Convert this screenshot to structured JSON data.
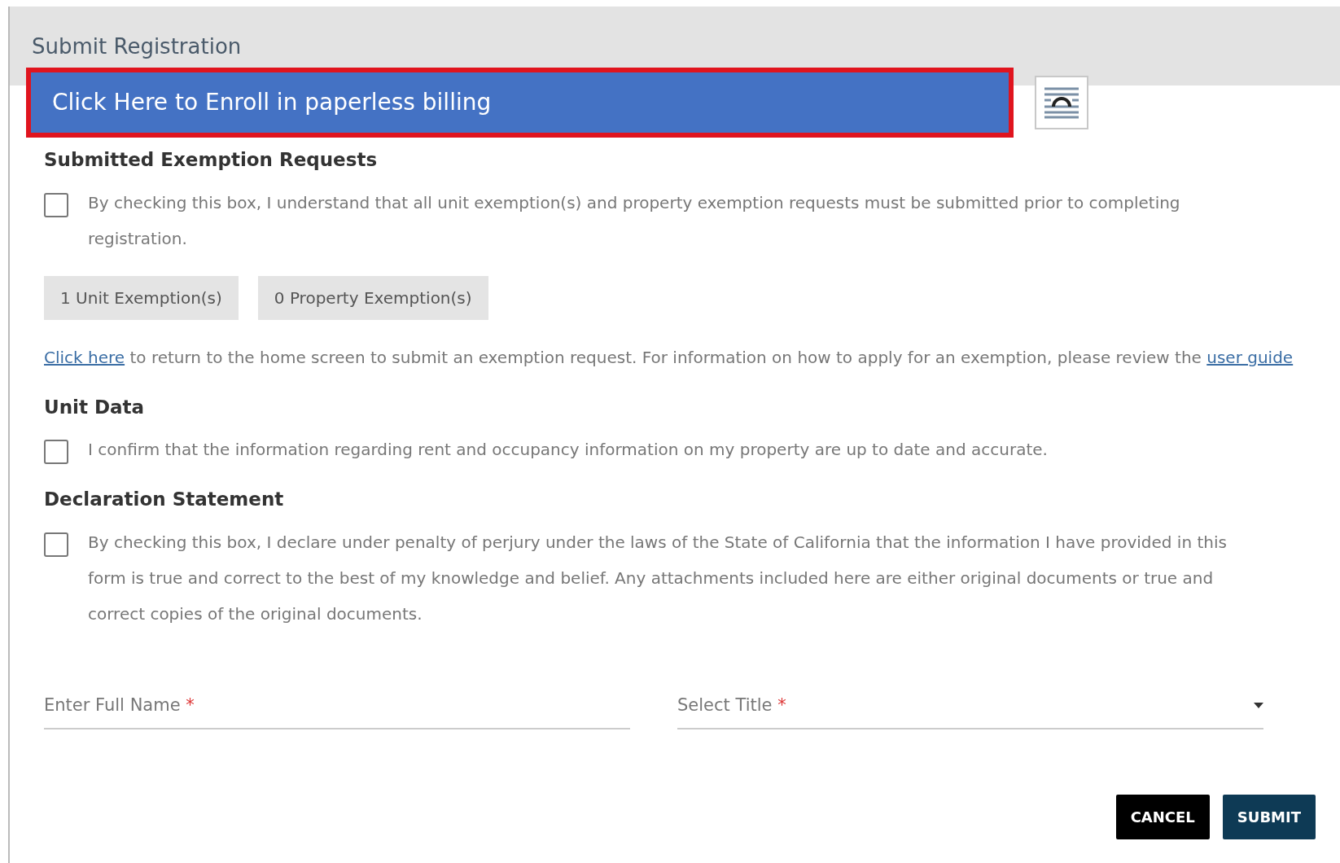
{
  "dialog": {
    "title": "Submit Registration"
  },
  "banner": {
    "label": "Click Here to Enroll in paperless billing"
  },
  "sections": [
    {
      "heading": "Submitted Exemption Requests",
      "checkbox": {
        "checked": false,
        "label": "By checking this box, I understand that all unit exemption(s) and property exemption requests must be submitted prior to completing registration."
      },
      "chips": [
        "1 Unit Exemption(s)",
        "0 Property Exemption(s)"
      ],
      "note": {
        "link1": "Click here",
        "text": " to return to the home screen to submit an exemption request. For information on how to apply for an exemption, please review the ",
        "link2": "user guide"
      }
    },
    {
      "heading": "Unit Data",
      "checkbox": {
        "checked": false,
        "label": "I confirm that the information regarding rent and occupancy information on my property are up to date and accurate."
      }
    },
    {
      "heading": "Declaration Statement",
      "checkbox": {
        "checked": false,
        "label": "By checking this box, I declare under penalty of perjury under the laws of the State of California that the information I have provided in this form is true and correct to the best of my knowledge and belief. Any attachments included here are either original documents or true and correct copies of the original documents."
      }
    }
  ],
  "fields": [
    {
      "kind": "text",
      "placeholder": "Enter Full Name",
      "required_mark": "*"
    },
    {
      "kind": "select",
      "placeholder": "Select Title",
      "required_mark": "*"
    }
  ],
  "buttons": [
    {
      "kind": "dark",
      "label": "CANCEL"
    },
    {
      "kind": "primary",
      "label": "SUBMIT"
    }
  ]
}
